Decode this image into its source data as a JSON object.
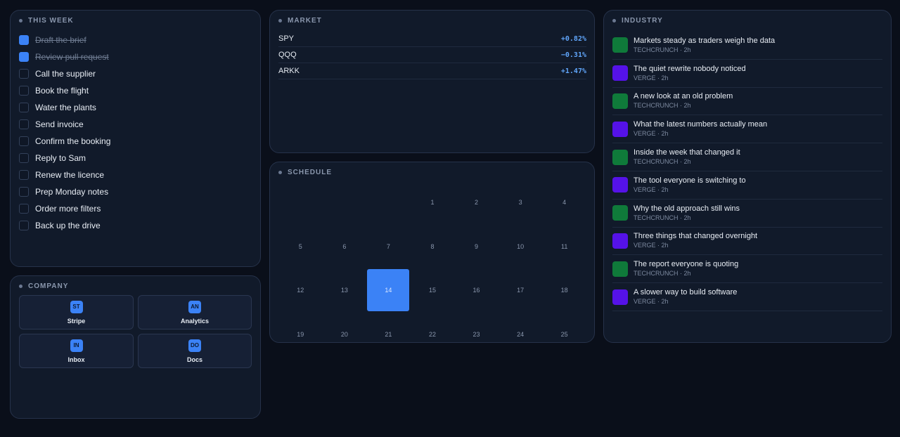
{
  "colors": {
    "accent": "#3b82f6",
    "techcrunch": "#0f7a3a",
    "verge": "#5512e8"
  },
  "week": {
    "title": "THIS WEEK",
    "todos": [
      {
        "label": "Draft the brief",
        "done": true
      },
      {
        "label": "Review pull request",
        "done": true
      },
      {
        "label": "Call the supplier",
        "done": false
      },
      {
        "label": "Book the flight",
        "done": false
      },
      {
        "label": "Water the plants",
        "done": false
      },
      {
        "label": "Send invoice",
        "done": false
      },
      {
        "label": "Confirm the booking",
        "done": false
      },
      {
        "label": "Reply to Sam",
        "done": false
      },
      {
        "label": "Renew the licence",
        "done": false
      },
      {
        "label": "Prep Monday notes",
        "done": false
      },
      {
        "label": "Order more filters",
        "done": false
      },
      {
        "label": "Back up the drive",
        "done": false
      }
    ]
  },
  "company": {
    "title": "COMPANY",
    "tiles": [
      {
        "badge": "ST",
        "name": "Stripe"
      },
      {
        "badge": "AN",
        "name": "Analytics"
      },
      {
        "badge": "IN",
        "name": "Inbox"
      },
      {
        "badge": "DO",
        "name": "Docs"
      }
    ]
  },
  "market": {
    "title": "MARKET",
    "tickers": [
      {
        "symbol": "SPY",
        "change": "+0.82%"
      },
      {
        "symbol": "QQQ",
        "change": "−0.31%"
      },
      {
        "symbol": "ARKK",
        "change": "+1.47%"
      }
    ]
  },
  "schedule": {
    "title": "SCHEDULE",
    "leading_blanks": 3,
    "days": [
      "1",
      "2",
      "3",
      "4",
      "5",
      "6",
      "7",
      "8",
      "9",
      "10",
      "11",
      "12",
      "13",
      "14",
      "15",
      "16",
      "17",
      "18",
      "19",
      "20",
      "21",
      "22",
      "23",
      "24",
      "25"
    ],
    "today": "14"
  },
  "industry": {
    "title": "INDUSTRY",
    "items": [
      {
        "title": "Markets steady as traders weigh the data",
        "meta": "TECHCRUNCH · 2h",
        "source": "techcrunch"
      },
      {
        "title": "The quiet rewrite nobody noticed",
        "meta": "VERGE · 2h",
        "source": "verge"
      },
      {
        "title": "A new look at an old problem",
        "meta": "TECHCRUNCH · 2h",
        "source": "techcrunch"
      },
      {
        "title": "What the latest numbers actually mean",
        "meta": "VERGE · 2h",
        "source": "verge"
      },
      {
        "title": "Inside the week that changed it",
        "meta": "TECHCRUNCH · 2h",
        "source": "techcrunch"
      },
      {
        "title": "The tool everyone is switching to",
        "meta": "VERGE · 2h",
        "source": "verge"
      },
      {
        "title": "Why the old approach still wins",
        "meta": "TECHCRUNCH · 2h",
        "source": "techcrunch"
      },
      {
        "title": "Three things that changed overnight",
        "meta": "VERGE · 2h",
        "source": "verge"
      },
      {
        "title": "The report everyone is quoting",
        "meta": "TECHCRUNCH · 2h",
        "source": "techcrunch"
      },
      {
        "title": "A slower way to build software",
        "meta": "VERGE · 2h",
        "source": "verge"
      }
    ]
  }
}
